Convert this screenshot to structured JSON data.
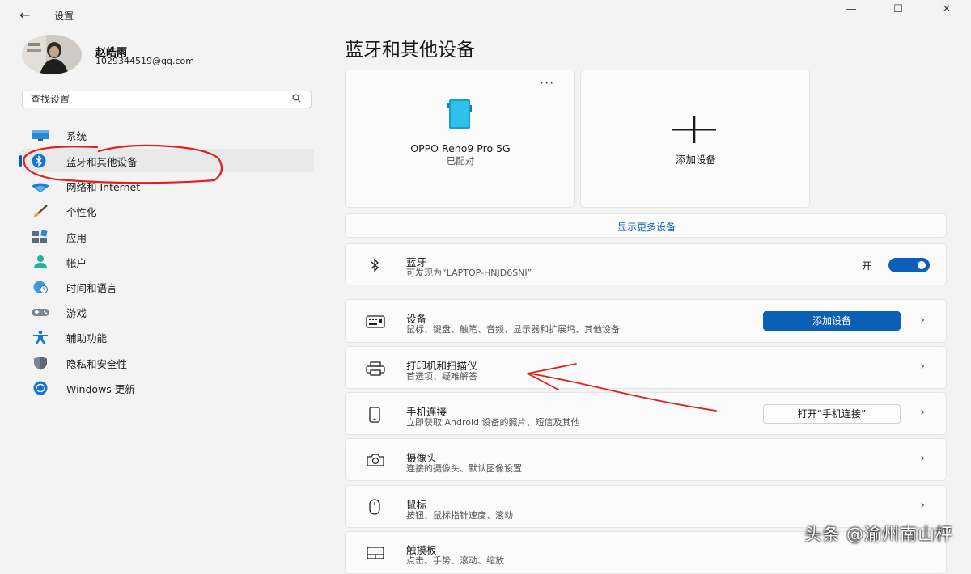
{
  "window": {
    "title": "设置",
    "minimize_glyph": "—",
    "maximize_glyph": "☐",
    "close_glyph": "✕",
    "back_glyph": "←"
  },
  "profile": {
    "name": "赵皓雨",
    "email": "1029344519@qq.com"
  },
  "search": {
    "placeholder": "查找设置",
    "value": ""
  },
  "sidebar": {
    "items": [
      {
        "label": "系统",
        "icon": "monitor-icon",
        "selected": false
      },
      {
        "label": "蓝牙和其他设备",
        "icon": "bluetooth-icon",
        "selected": true
      },
      {
        "label": "网络和 Internet",
        "icon": "wifi-icon",
        "selected": false
      },
      {
        "label": "个性化",
        "icon": "brush-icon",
        "selected": false
      },
      {
        "label": "应用",
        "icon": "apps-icon",
        "selected": false
      },
      {
        "label": "帐户",
        "icon": "person-icon",
        "selected": false
      },
      {
        "label": "时间和语言",
        "icon": "globe-clock-icon",
        "selected": false
      },
      {
        "label": "游戏",
        "icon": "gamepad-icon",
        "selected": false
      },
      {
        "label": "辅助功能",
        "icon": "accessibility-icon",
        "selected": false
      },
      {
        "label": "隐私和安全性",
        "icon": "shield-icon",
        "selected": false
      },
      {
        "label": "Windows 更新",
        "icon": "update-icon",
        "selected": false
      }
    ]
  },
  "main": {
    "title": "蓝牙和其他设备",
    "device_card": {
      "name": "OPPO Reno9 Pro 5G",
      "status": "已配对",
      "more": "···"
    },
    "add_card": {
      "label": "添加设备"
    },
    "show_more": "显示更多设备",
    "bluetooth": {
      "title": "蓝牙",
      "subtitle": "可发现为“LAPTOP-HNJD6SNI”",
      "toggle_label": "开",
      "toggle_on": true
    },
    "rows": [
      {
        "title": "设备",
        "subtitle": "鼠标、键盘、触笔、音频、显示器和扩展坞、其他设备",
        "icon": "keyboard-icon",
        "button": "添加设备",
        "button_style": "primary"
      },
      {
        "title": "打印机和扫描仪",
        "subtitle": "首选项、疑难解答",
        "icon": "printer-icon"
      },
      {
        "title": "手机连接",
        "subtitle": "立即获取 Android 设备的照片、短信及其他",
        "icon": "phone-icon",
        "button": "打开“手机连接”",
        "button_style": "secondary"
      },
      {
        "title": "摄像头",
        "subtitle": "连接的摄像头、默认图像设置",
        "icon": "camera-icon"
      },
      {
        "title": "鼠标",
        "subtitle": "按钮、鼠标指针速度、滚动",
        "icon": "mouse-icon"
      },
      {
        "title": "触摸板",
        "subtitle": "点击、手势、滚动、缩放",
        "icon": "touchpad-icon"
      }
    ],
    "chevron": "›"
  },
  "watermark": "头条 @渝州南山枰",
  "colors": {
    "accent": "#0c5fb8",
    "annotation": "#e0201b",
    "background": "#f3f3f3",
    "card": "#fbfbfb"
  }
}
